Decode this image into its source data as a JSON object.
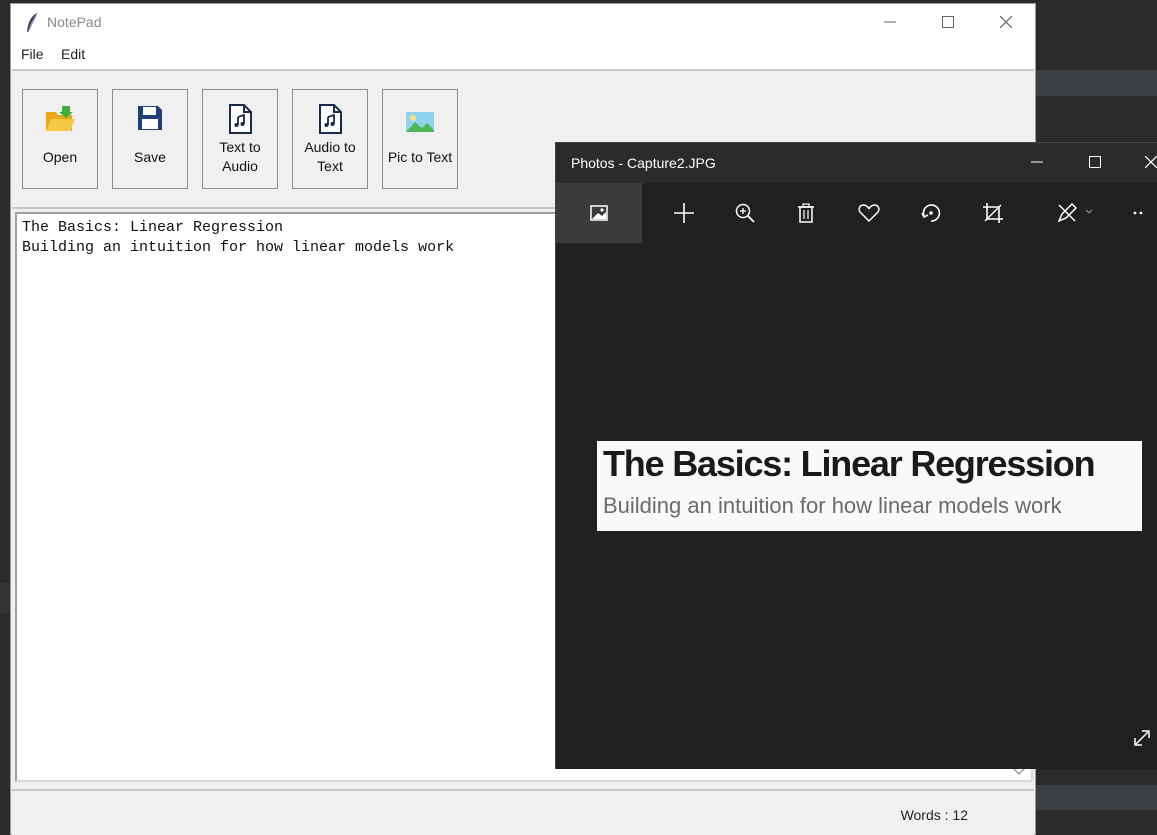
{
  "notepad": {
    "title": "NotePad",
    "menu": [
      "File",
      "Edit"
    ],
    "toolbar": [
      {
        "label_1": "Open",
        "label_2": "",
        "icon": "folder-open-icon"
      },
      {
        "label_1": "Save",
        "label_2": "",
        "icon": "floppy-save-icon"
      },
      {
        "label_1": "Text to",
        "label_2": "Audio",
        "icon": "audio-file-icon"
      },
      {
        "label_1": "Audio to",
        "label_2": "Text",
        "icon": "audio-file-icon"
      },
      {
        "label_1": "Pic to Text",
        "label_2": "",
        "icon": "image-icon"
      }
    ],
    "content_lines": [
      "The Basics: Linear Regression",
      "Building an intuition for how linear models work"
    ],
    "status_words": "Words : 12"
  },
  "photos": {
    "title": "Photos - Capture2.JPG",
    "toolbar_icons": [
      "image-view-icon",
      "add-icon",
      "zoom-in-icon",
      "delete-icon",
      "favorite-heart-icon",
      "rotate-icon",
      "crop-icon",
      "edit-draw-icon",
      "more-icon"
    ],
    "image_heading": "The Basics: Linear Regression",
    "image_subheading": "Building an intuition for how linear models work"
  },
  "colors": {
    "notepad_bg": "#f0f0f0",
    "photos_bg": "#202020",
    "photos_titlebar": "#2b2b2b"
  }
}
